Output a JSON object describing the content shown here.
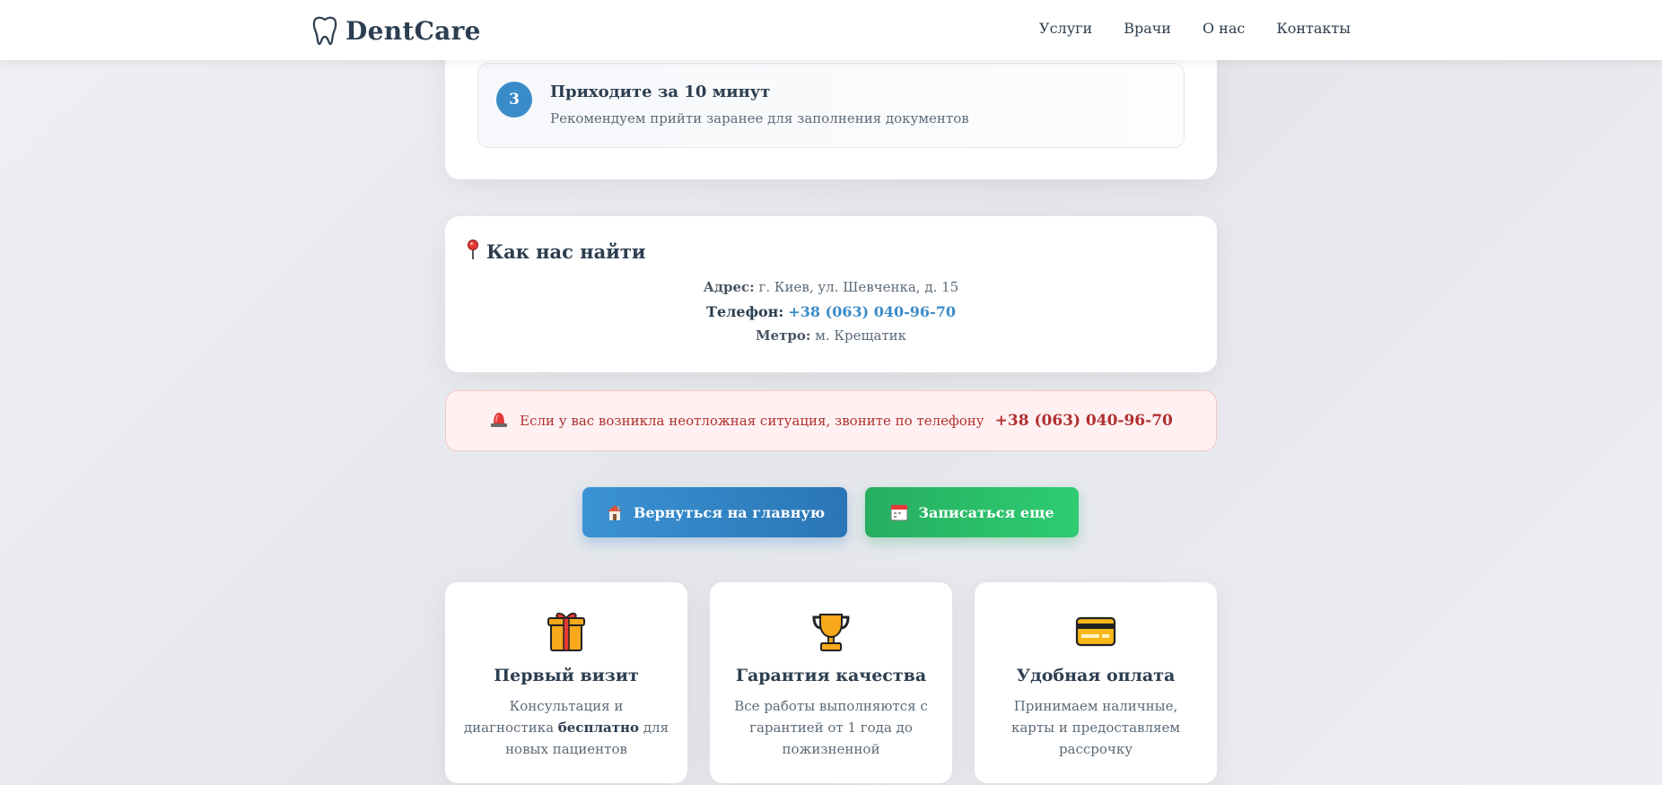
{
  "header": {
    "brand": "DentCare",
    "nav": [
      "Услуги",
      "Врачи",
      "О нас",
      "Контакты"
    ]
  },
  "steps": {
    "step3": {
      "number": "3",
      "title": "Приходите за 10 минут",
      "description": "Рекомендуем прийти заранее для заполнения документов"
    }
  },
  "location": {
    "title": "Как нас найти",
    "address_label": "Адрес:",
    "address_value": "г. Киев, ул. Шевченка, д. 15",
    "phone_label": "Телефон:",
    "phone_value": "+38 (063) 040-96-70",
    "metro_label": "Метро:",
    "metro_value": "м. Крещатик"
  },
  "emergency": {
    "text": "Если у вас возникла неотложная ситуация, звоните по телефону",
    "phone": "+38 (063) 040-96-70"
  },
  "buttons": {
    "home": "Вернуться на главную",
    "book": "Записаться еще"
  },
  "features": {
    "first_visit": {
      "title": "Первый визит",
      "desc_pre": "Консультация и диагностика",
      "desc_bold": "бесплатно",
      "desc_post": "для новых пациентов"
    },
    "quality": {
      "title": "Гарантия качества",
      "desc": "Все работы выполняются с гарантией от 1 года до пожизненной"
    },
    "payment": {
      "title": "Удобная оплата",
      "desc": "Принимаем наличные, карты и предоставляем рассрочку"
    }
  },
  "colors": {
    "primary": "#3a8cc9",
    "success": "#27ae60",
    "danger": "#b03030",
    "text": "#2c3e50"
  }
}
